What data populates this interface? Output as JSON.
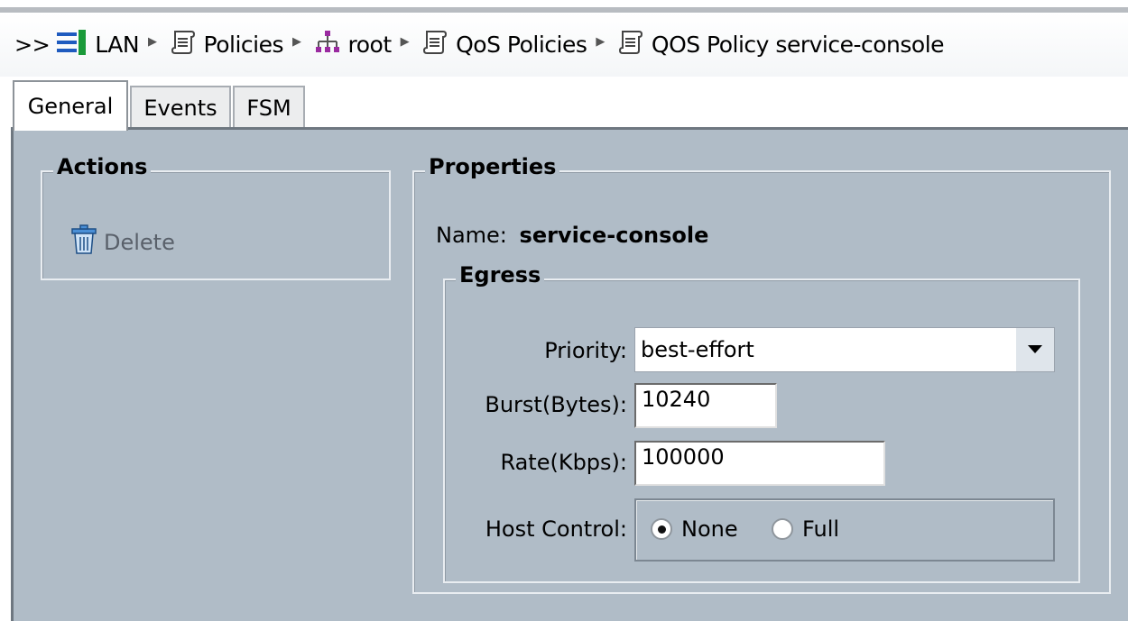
{
  "breadcrumb": {
    "prefix": ">>",
    "items": [
      {
        "label": "LAN",
        "icon": "lan-icon"
      },
      {
        "label": "Policies",
        "icon": "policy-scroll-icon"
      },
      {
        "label": "root",
        "icon": "org-tree-icon"
      },
      {
        "label": "QoS Policies",
        "icon": "policy-scroll-icon"
      },
      {
        "label": "QOS Policy service-console",
        "icon": "policy-scroll-icon"
      }
    ]
  },
  "tabs": [
    {
      "label": "General",
      "active": true
    },
    {
      "label": "Events",
      "active": false
    },
    {
      "label": "FSM",
      "active": false
    }
  ],
  "actions": {
    "title": "Actions",
    "delete_label": "Delete"
  },
  "properties": {
    "title": "Properties",
    "name_label": "Name:",
    "name_value": "service-console",
    "egress": {
      "title": "Egress",
      "priority_label": "Priority:",
      "priority_value": "best-effort",
      "burst_label": "Burst(Bytes):",
      "burst_value": "10240",
      "rate_label": "Rate(Kbps):",
      "rate_value": "100000",
      "host_control_label": "Host Control:",
      "host_control_options": [
        {
          "label": "None",
          "selected": true
        },
        {
          "label": "Full",
          "selected": false
        }
      ]
    }
  },
  "colors": {
    "panel_bg": "#b0bcc7",
    "lan_icon": "#1f5bbf",
    "org_icon": "#9a2aa0"
  }
}
